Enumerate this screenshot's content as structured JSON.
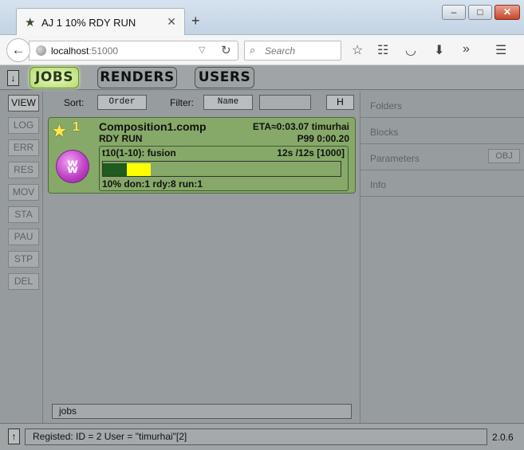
{
  "browser": {
    "tab_title": "AJ 1 10% RDY RUN",
    "url_host": "localhost",
    "url_port": ":51000",
    "search_placeholder": "Search"
  },
  "topbar": {
    "jobs_label": "JOBS",
    "renders_label": "RENDERS",
    "users_label": "USERS",
    "down_arrow": "↓"
  },
  "sidebar": {
    "items": [
      {
        "label": "VIEW"
      },
      {
        "label": "LOG"
      },
      {
        "label": "ERR"
      },
      {
        "label": "RES"
      },
      {
        "label": "MOV"
      },
      {
        "label": "STA"
      },
      {
        "label": "PAU"
      },
      {
        "label": "STP"
      },
      {
        "label": "DEL"
      }
    ]
  },
  "filterbar": {
    "sort_label": "Sort:",
    "sort_value": "Order",
    "filter_label": "Filter:",
    "filter_value": "Name",
    "filter_text": "",
    "h_label": "H"
  },
  "job": {
    "priority": "1",
    "name": "Composition1.comp",
    "eta": "ETA≈0:03.07 timurhai",
    "state": "RDY RUN",
    "time": "P99 0:00.20",
    "block": {
      "name": "t10(1-10): fusion",
      "time": "12s /12s [1000]",
      "stats": "10% don:1 rdy:8 run:1",
      "progress": [
        {
          "done": 0.1,
          "running": 0.1
        },
        {
          "done": 0.1,
          "running": 0.1
        }
      ]
    },
    "colors": {
      "card": "#86a969",
      "done": "#1f5b1f",
      "running": "#ffff00"
    }
  },
  "jobs_field": "jobs",
  "right_panel": {
    "folders": "Folders",
    "blocks": "Blocks",
    "parameters": "Parameters",
    "obj_label": "OBJ",
    "info": "Info"
  },
  "statusbar": {
    "up_arrow": "↑",
    "message": "Registed: ID = 2 User = \"timurhai\"[2]",
    "version": "2.0.6"
  }
}
